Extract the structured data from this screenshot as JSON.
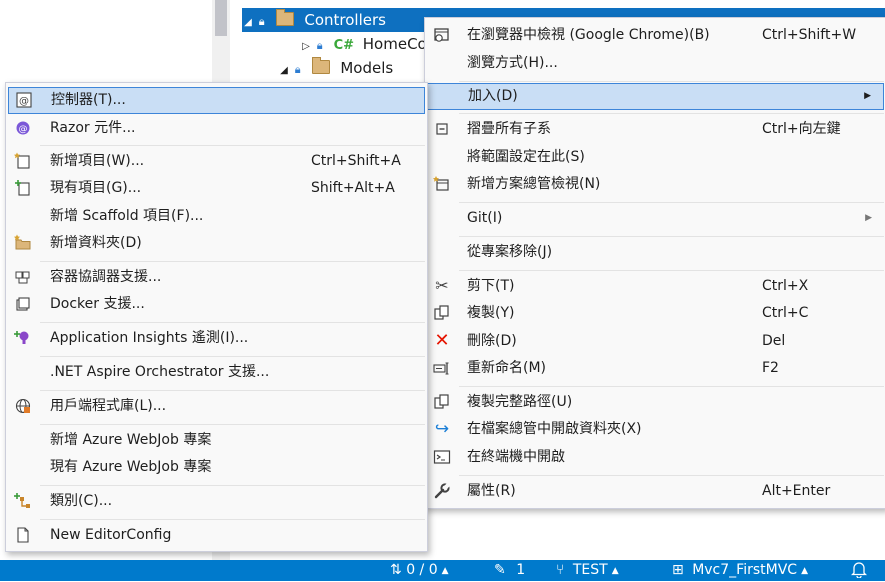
{
  "tree": {
    "controllers_label": "Controllers",
    "homecontroller_label": "HomeCor",
    "models_label": "Models",
    "cs_badge": "C#"
  },
  "context_menu": {
    "items": [
      {
        "label": "在瀏覽器中檢視 (Google Chrome)(B)",
        "shortcut": "Ctrl+Shift+W",
        "icon": "browser-view-icon"
      },
      {
        "label": "瀏覽方式(H)...",
        "shortcut": "",
        "icon": ""
      },
      {
        "label": "加入(D)",
        "shortcut": "",
        "icon": "",
        "submenu": true,
        "highlighted": true
      },
      {
        "label": "摺疊所有子系",
        "shortcut": "Ctrl+向左鍵",
        "icon": "collapse-all-icon"
      },
      {
        "label": "將範圍設定在此(S)",
        "shortcut": "",
        "icon": ""
      },
      {
        "label": "新增方案總管檢視(N)",
        "shortcut": "",
        "icon": "new-explorer-view-icon"
      },
      {
        "label": "Git(I)",
        "shortcut": "",
        "icon": "",
        "submenu": true
      },
      {
        "label": "從專案移除(J)",
        "shortcut": "",
        "icon": ""
      },
      {
        "label": "剪下(T)",
        "shortcut": "Ctrl+X",
        "icon": "scissors-icon"
      },
      {
        "label": "複製(Y)",
        "shortcut": "Ctrl+C",
        "icon": "copy-icon"
      },
      {
        "label": "刪除(D)",
        "shortcut": "Del",
        "icon": "delete-icon"
      },
      {
        "label": "重新命名(M)",
        "shortcut": "F2",
        "icon": "rename-icon"
      },
      {
        "label": "複製完整路徑(U)",
        "shortcut": "",
        "icon": "copy-path-icon"
      },
      {
        "label": "在檔案總管中開啟資料夾(X)",
        "shortcut": "",
        "icon": "open-folder-arrow-icon"
      },
      {
        "label": "在終端機中開啟",
        "shortcut": "",
        "icon": "terminal-icon"
      },
      {
        "label": "屬性(R)",
        "shortcut": "Alt+Enter",
        "icon": "wrench-icon"
      }
    ]
  },
  "add_submenu": {
    "items": [
      {
        "label": "控制器(T)...",
        "shortcut": "",
        "icon": "controller-icon",
        "highlighted": true
      },
      {
        "label": "Razor 元件...",
        "shortcut": "",
        "icon": "razor-component-icon"
      },
      {
        "label": "新增項目(W)...",
        "shortcut": "Ctrl+Shift+A",
        "icon": "new-item-icon"
      },
      {
        "label": "現有項目(G)...",
        "shortcut": "Shift+Alt+A",
        "icon": "existing-item-icon"
      },
      {
        "label": "新增 Scaffold 項目(F)...",
        "shortcut": "",
        "icon": ""
      },
      {
        "label": "新增資料夾(D)",
        "shortcut": "",
        "icon": "new-folder-icon"
      },
      {
        "label": "容器協調器支援...",
        "shortcut": "",
        "icon": "container-orchestrator-icon"
      },
      {
        "label": "Docker 支援...",
        "shortcut": "",
        "icon": "docker-icon"
      },
      {
        "label": "Application Insights 遙測(I)...",
        "shortcut": "",
        "icon": "app-insights-icon"
      },
      {
        "label": ".NET Aspire Orchestrator 支援...",
        "shortcut": "",
        "icon": ""
      },
      {
        "label": "用戶端程式庫(L)...",
        "shortcut": "",
        "icon": "client-library-icon"
      },
      {
        "label": "新增 Azure WebJob 專案",
        "shortcut": "",
        "icon": ""
      },
      {
        "label": "現有 Azure WebJob 專案",
        "shortcut": "",
        "icon": ""
      },
      {
        "label": "類別(C)...",
        "shortcut": "",
        "icon": "class-icon"
      },
      {
        "label": "New EditorConfig",
        "shortcut": "",
        "icon": "editorconfig-icon"
      }
    ]
  },
  "status_bar": {
    "sync": "0 / 0",
    "edits": "1",
    "branch": "TEST",
    "repo": "Mvc7_FirstMVC"
  },
  "colors": {
    "status_bar": "#007acc",
    "selection": "#0e70c0",
    "menu_highlight": "#c9def5",
    "menu_highlight_border": "#3d85d9"
  }
}
